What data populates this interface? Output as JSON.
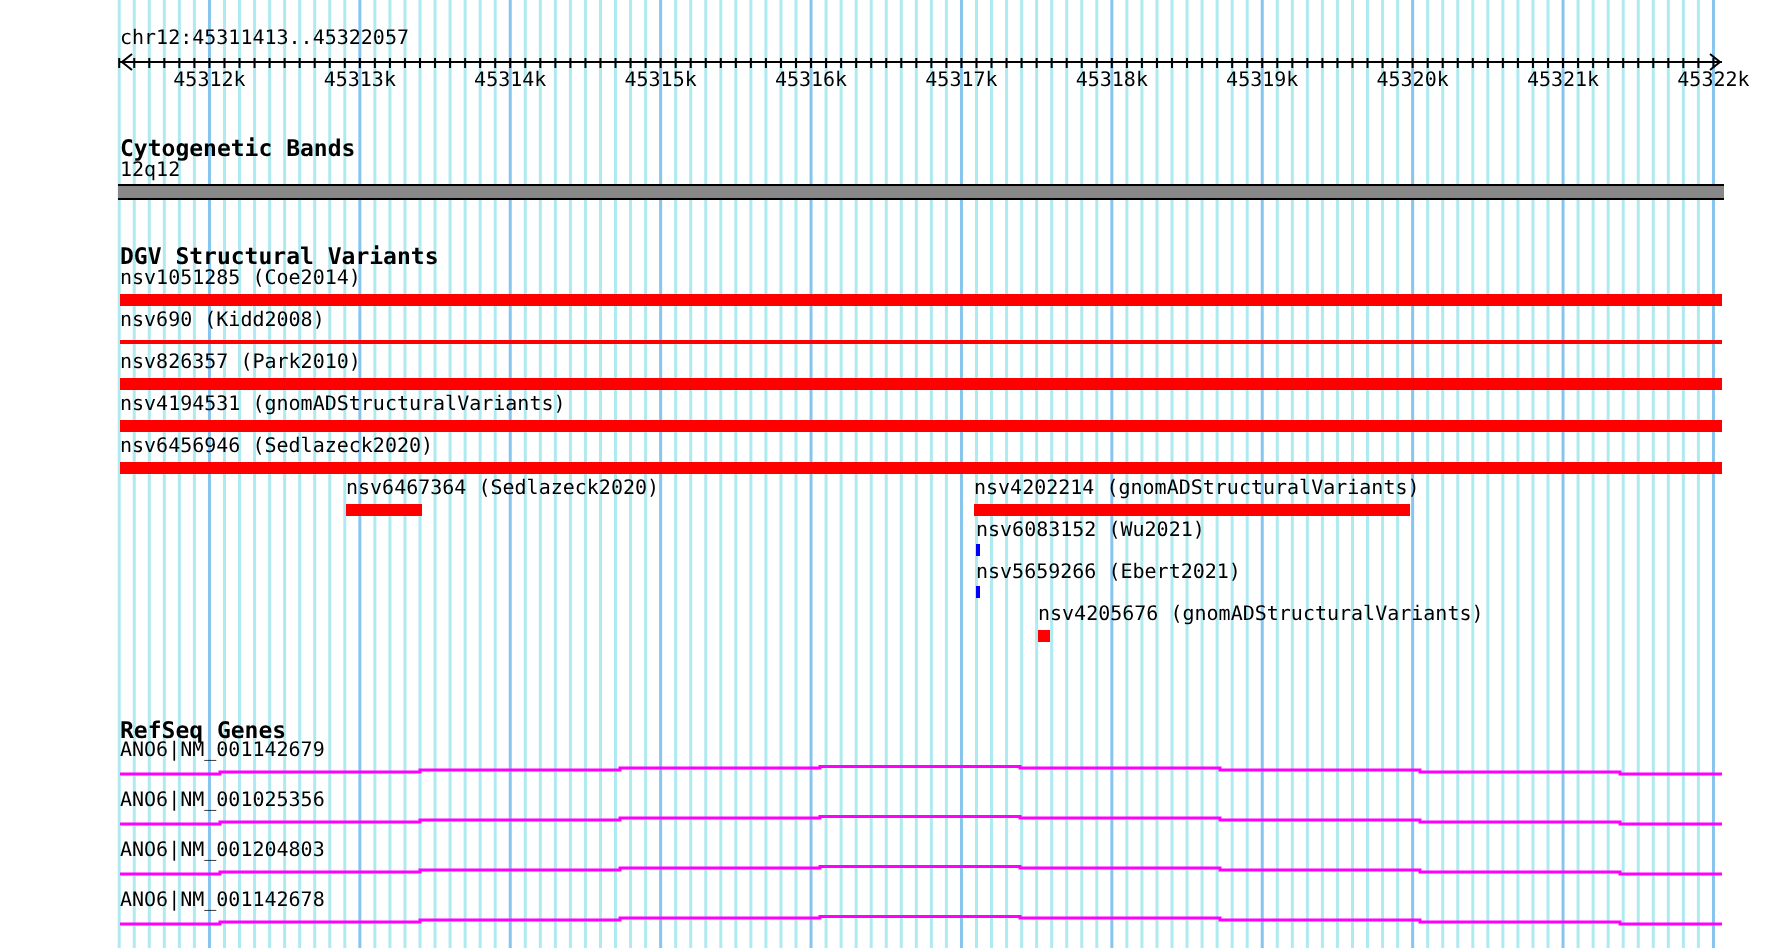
{
  "ruler": {
    "location": "chr12:45311413..45322057",
    "ticks": [
      "45312k",
      "45313k",
      "45314k",
      "45315k",
      "45316k",
      "45317k",
      "45318k",
      "45319k",
      "45320k",
      "45321k",
      "45322k"
    ]
  },
  "tracks": [
    {
      "kind": "bands",
      "title": "Cytogenetic Bands",
      "features": [
        {
          "label": "12q12"
        }
      ]
    },
    {
      "kind": "variants",
      "title": "DGV Structural Variants",
      "features": [
        {
          "label": "nsv1051285 (Coe2014)",
          "color": "#ff0000"
        },
        {
          "label": "nsv690 (Kidd2008)",
          "color": "#ff0000"
        },
        {
          "label": "nsv826357 (Park2010)",
          "color": "#ff0000"
        },
        {
          "label": "nsv4194531 (gnomADStructuralVariants)",
          "color": "#ff0000"
        },
        {
          "label": "nsv6456946 (Sedlazeck2020)",
          "color": "#ff0000"
        },
        {
          "label": "nsv6467364 (Sedlazeck2020)",
          "color": "#ff0000"
        },
        {
          "label": "nsv4202214 (gnomADStructuralVariants)",
          "color": "#ff0000"
        },
        {
          "label": "nsv6083152 (Wu2021)",
          "color": "#0000ff"
        },
        {
          "label": "nsv5659266 (Ebert2021)",
          "color": "#0000ff"
        },
        {
          "label": "nsv4205676 (gnomADStructuralVariants)",
          "color": "#ff0000"
        }
      ]
    },
    {
      "kind": "genes",
      "title": "RefSeq Genes",
      "features": [
        {
          "label": "ANO6|NM_001142679"
        },
        {
          "label": "ANO6|NM_001025356"
        },
        {
          "label": "ANO6|NM_001204803"
        },
        {
          "label": "ANO6|NM_001142678"
        }
      ]
    }
  ]
}
